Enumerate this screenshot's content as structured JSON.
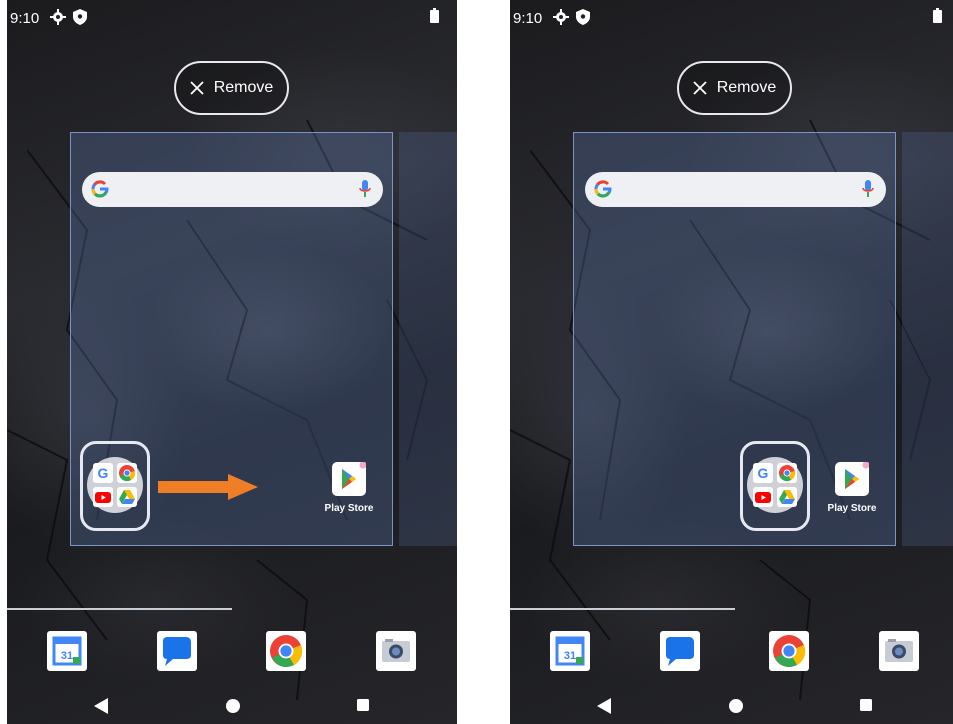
{
  "screens": [
    {
      "status_bar": {
        "time": "9:10"
      },
      "remove_button": {
        "label": "Remove"
      },
      "workspace": {
        "folder": {
          "apps": [
            "google-icon",
            "chrome-icon",
            "youtube-icon",
            "drive-icon"
          ]
        },
        "app": {
          "label": "Play Store",
          "icon": "play-store-icon"
        }
      },
      "dock": {
        "apps": [
          "calendar-icon",
          "messages-icon",
          "chrome-icon",
          "camera-icon"
        ],
        "calendar_day": "31"
      }
    },
    {
      "status_bar": {
        "time": "9:10"
      },
      "remove_button": {
        "label": "Remove"
      },
      "workspace": {
        "folder": {
          "apps": [
            "google-icon",
            "chrome-icon",
            "youtube-icon",
            "drive-icon"
          ]
        },
        "app": {
          "label": "Play Store",
          "icon": "play-store-icon"
        }
      },
      "dock": {
        "apps": [
          "calendar-icon",
          "messages-icon",
          "chrome-icon",
          "camera-icon"
        ],
        "calendar_day": "31"
      }
    }
  ],
  "colors": {
    "highlight_outline": "#e6e9f2",
    "drop_target": "#7d93c5",
    "arrow": "#f07e26"
  }
}
